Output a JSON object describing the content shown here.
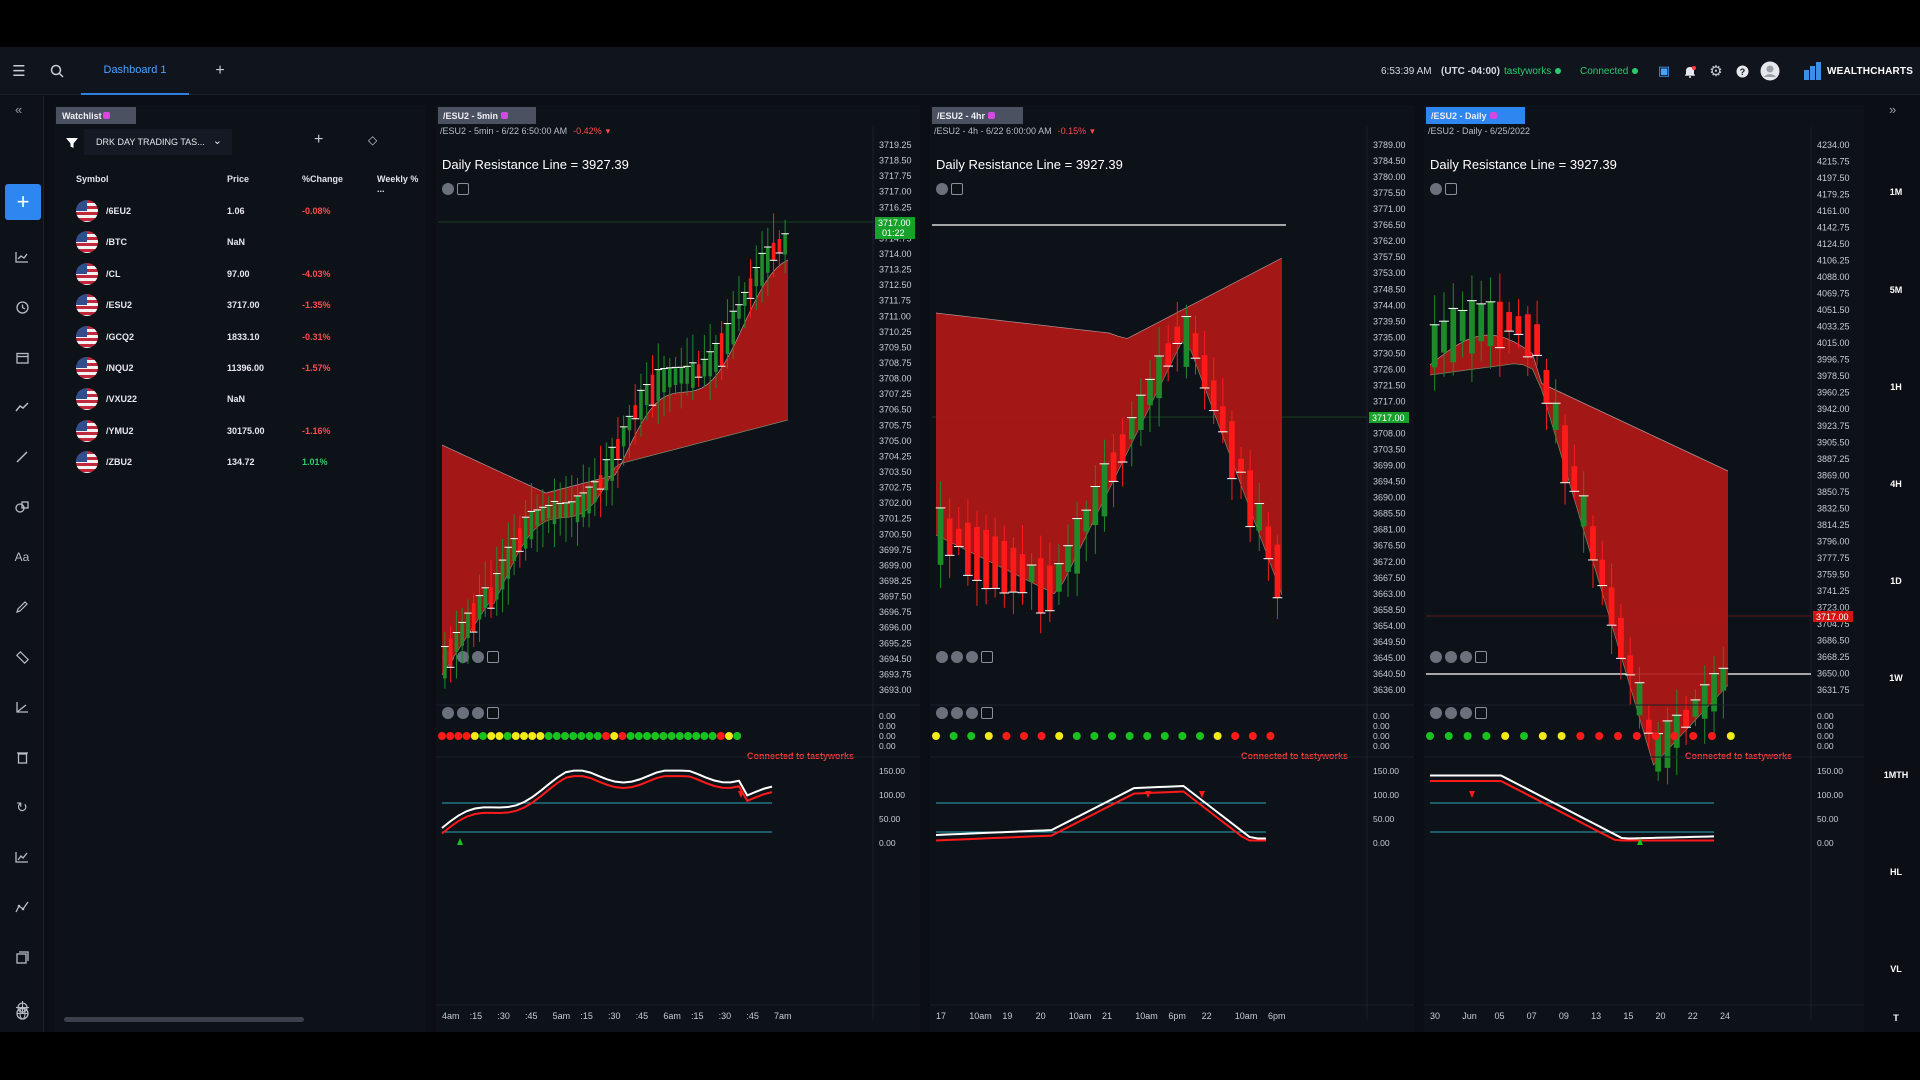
{
  "header": {
    "tab_label": "Dashboard 1",
    "time": "6:53:39 AM",
    "timezone": "(UTC -04:00)",
    "broker": "tastyworks",
    "connection": "Connected",
    "brand": "WEALTHCHARTS"
  },
  "left_tools": [
    "menu-icon",
    "chart-type-icon",
    "clock-icon",
    "calendar-icon",
    "trend-icon",
    "line-tool-icon",
    "shapes-icon",
    "text-tool-icon",
    "pencil-icon",
    "ruler-icon",
    "measure-icon",
    "trash-icon",
    "refresh-icon",
    "indicator-icon",
    "pattern-icon",
    "layers-icon",
    "crosshair-icon",
    "globe-icon"
  ],
  "watchlist": {
    "tab": "Watchlist",
    "list_name": "DRK DAY TRADING TAS...",
    "columns": [
      "Symbol",
      "Price",
      "%Change",
      "Weekly % ..."
    ],
    "rows": [
      {
        "symbol": "/6EU2",
        "price": "1.06",
        "change": "-0.08%"
      },
      {
        "symbol": "/BTC",
        "price": "NaN",
        "change": ""
      },
      {
        "symbol": "/CL",
        "price": "97.00",
        "change": "-4.03%"
      },
      {
        "symbol": "/ESU2",
        "price": "3717.00",
        "change": "-1.35%"
      },
      {
        "symbol": "/GCQ2",
        "price": "1833.10",
        "change": "-0.31%"
      },
      {
        "symbol": "/NQU2",
        "price": "11396.00",
        "change": "-1.57%"
      },
      {
        "symbol": "/VXU22",
        "price": "NaN",
        "change": ""
      },
      {
        "symbol": "/YMU2",
        "price": "30175.00",
        "change": "-1.16%"
      },
      {
        "symbol": "/ZBU2",
        "price": "134.72",
        "change": "1.01%"
      }
    ]
  },
  "charts": [
    {
      "tab": "/ESU2 - 5min",
      "info": "/ESU2 - 5min - 6/22 6:50:00 AM",
      "info_change": "-0.42%",
      "annotation": "Daily Resistance Line = 3927.39",
      "connected": "Connected to tastyworks",
      "price_axis": [
        "3719.25",
        "3718.50",
        "3717.75",
        "3717.00",
        "3716.25",
        "3715.50",
        "3714.75",
        "3714.00",
        "3713.25",
        "3712.50",
        "3711.75",
        "3711.00",
        "3710.25",
        "3709.50",
        "3708.75",
        "3708.00",
        "3707.25",
        "3706.50",
        "3705.75",
        "3705.00",
        "3704.25",
        "3703.50",
        "3702.75",
        "3702.00",
        "3701.25",
        "3700.50",
        "3699.75",
        "3699.00",
        "3698.25",
        "3697.50",
        "3696.75",
        "3696.00",
        "3695.25",
        "3694.50",
        "3693.75",
        "3693.00"
      ],
      "last_price": "3717.00",
      "countdown": "01:22",
      "time_axis": [
        "4am",
        ":15",
        ":30",
        ":45",
        "5am",
        ":15",
        ":30",
        ":45",
        "6am",
        ":15",
        ":30",
        ":45",
        "7am"
      ],
      "dot_colors": [
        "r",
        "r",
        "r",
        "r",
        "y",
        "g",
        "y",
        "y",
        "g",
        "y",
        "y",
        "y",
        "y",
        "g",
        "g",
        "g",
        "g",
        "g",
        "g",
        "g",
        "r",
        "y",
        "r",
        "g",
        "g",
        "g",
        "g",
        "g",
        "g",
        "g",
        "g",
        "g",
        "g",
        "g",
        "r",
        "y",
        "g"
      ]
    },
    {
      "tab": "/ESU2 - 4hr",
      "info": "/ESU2 - 4h - 6/22 6:00:00 AM",
      "info_change": "-0.15%",
      "annotation": "Daily Resistance Line = 3927.39",
      "connected": "Connected to tastyworks",
      "price_axis": [
        "3789.00",
        "3784.50",
        "3780.00",
        "3775.50",
        "3771.00",
        "3766.50",
        "3762.00",
        "3757.50",
        "3753.00",
        "3748.50",
        "3744.00",
        "3739.50",
        "3735.00",
        "3730.50",
        "3726.00",
        "3721.50",
        "3717.00",
        "3712.50",
        "3708.00",
        "3703.50",
        "3699.00",
        "3694.50",
        "3690.00",
        "3685.50",
        "3681.00",
        "3676.50",
        "3672.00",
        "3667.50",
        "3663.00",
        "3658.50",
        "3654.00",
        "3649.50",
        "3645.00",
        "3640.50",
        "3636.00"
      ],
      "last_price": "3717.00",
      "time_axis": [
        "17",
        "10am",
        "19",
        "20",
        "10am",
        "21",
        "10am",
        "6pm",
        "22",
        "10am",
        "6pm"
      ],
      "dot_colors": [
        "y",
        "g",
        "g",
        "y",
        "r",
        "r",
        "r",
        "y",
        "g",
        "g",
        "g",
        "g",
        "g",
        "g",
        "g",
        "g",
        "y",
        "r",
        "r",
        "r"
      ]
    },
    {
      "tab": "/ESU2 - Daily",
      "info": "/ESU2 - Daily - 6/25/2022",
      "info_change": "",
      "annotation": "Daily Resistance Line = 3927.39",
      "connected": "Connected to tastyworks",
      "price_axis": [
        "4234.00",
        "4215.75",
        "4197.50",
        "4179.25",
        "4161.00",
        "4142.75",
        "4124.50",
        "4106.25",
        "4088.00",
        "4069.75",
        "4051.50",
        "4033.25",
        "4015.00",
        "3996.75",
        "3978.50",
        "3960.25",
        "3942.00",
        "3923.75",
        "3905.50",
        "3887.25",
        "3869.00",
        "3850.75",
        "3832.50",
        "3814.25",
        "3796.00",
        "3777.75",
        "3759.50",
        "3741.25",
        "3723.00",
        "3704.75",
        "3686.50",
        "3668.25",
        "3650.00",
        "3631.75"
      ],
      "last_price": "3717.00",
      "time_axis": [
        "30",
        "Jun",
        "05",
        "07",
        "09",
        "13",
        "15",
        "20",
        "22",
        "24"
      ],
      "dot_colors": [
        "g",
        "g",
        "g",
        "g",
        "y",
        "g",
        "y",
        "y",
        "r",
        "r",
        "r",
        "r",
        "r",
        "r",
        "r",
        "r",
        "y"
      ]
    }
  ],
  "oscillator_axis": [
    "150.00",
    "100.00",
    "50.00",
    "0.00"
  ],
  "dot_axis": [
    "0.00",
    "0.00",
    "0.00",
    "0.00"
  ],
  "timeframes": [
    "1M",
    "5M",
    "1H",
    "4H",
    "1D",
    "1W",
    "1MTH",
    "HL",
    "VL",
    "T"
  ],
  "colors": {
    "up": "#1f8a2a",
    "down": "#ff1a1a",
    "cloud_red": "#b01818",
    "cloud_green": "#0f5c17",
    "accent": "#2e86f0"
  }
}
